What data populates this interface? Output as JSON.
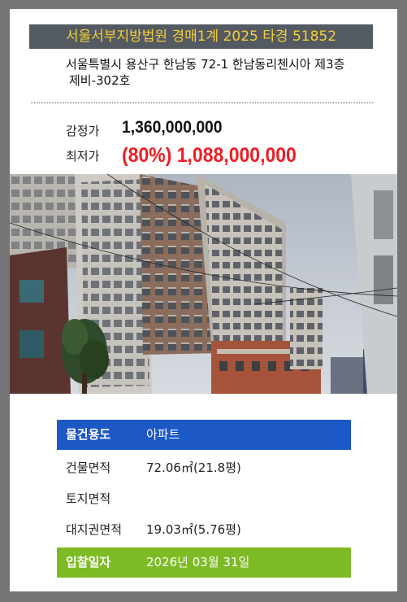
{
  "header": {
    "court_case": "서울서부지방법원 경매1계 2025 타경 51852"
  },
  "address": {
    "line1": "서울특별시 용산구 한남동 72-1 한남동리첸시아 제3층",
    "line2": "제비-302호"
  },
  "prices": {
    "appraisal_label": "감정가",
    "appraisal_value": "1,360,000,000",
    "minimum_label": "최저가",
    "minimum_value": "(80%) 1,088,000,000"
  },
  "details": [
    {
      "key": "물건용도",
      "value": "아파트"
    },
    {
      "key": "건물면적",
      "value": "72.06㎡(21.8평)"
    },
    {
      "key": "토지면적",
      "value": ""
    },
    {
      "key": "대지권면적",
      "value": "19.03㎡(5.76평)"
    },
    {
      "key": "입찰일자",
      "value": "2026년 03월 31일"
    }
  ],
  "colors": {
    "header_bg": "#545a61",
    "header_text": "#f2cf3a",
    "min_price": "#ee1d24",
    "usage_row": "#1c58c6",
    "bid_date_row": "#7dbb24"
  }
}
